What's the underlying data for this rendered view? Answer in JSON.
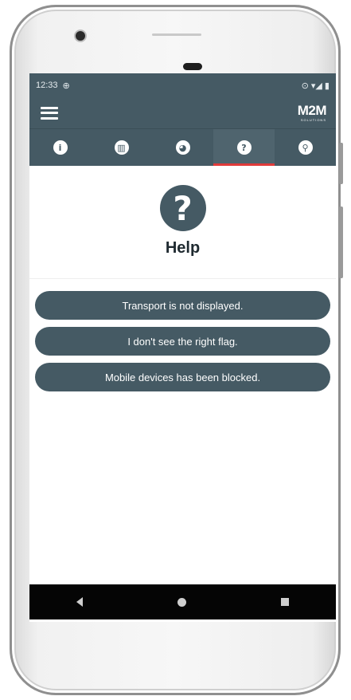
{
  "statusbar": {
    "time": "12:33",
    "left_icon": "sync-icon",
    "right_icons": "⊙ ▾◢ ▮"
  },
  "appbar": {
    "menu_icon": "hamburger-icon",
    "logo": "M2M",
    "logo_sub": "SOLUTIONS"
  },
  "tabs": [
    {
      "name": "info",
      "glyph": "i",
      "icon": "info-icon",
      "active": false
    },
    {
      "name": "map",
      "glyph": "▥",
      "icon": "map-icon",
      "active": false
    },
    {
      "name": "globe",
      "glyph": "◕",
      "icon": "globe-icon",
      "active": false
    },
    {
      "name": "help",
      "glyph": "?",
      "icon": "help-icon",
      "active": true
    },
    {
      "name": "search",
      "glyph": "⚲",
      "icon": "search-icon",
      "active": false
    }
  ],
  "help": {
    "glyph": "?",
    "title": "Help",
    "items": [
      "Transport is not displayed.",
      "I don't see the right flag.",
      "Mobile devices has been blocked."
    ]
  },
  "colors": {
    "primary": "#455a64",
    "active_tab_indicator": "#e03a3a",
    "background": "#ffffff",
    "nav_bar": "#050505"
  }
}
